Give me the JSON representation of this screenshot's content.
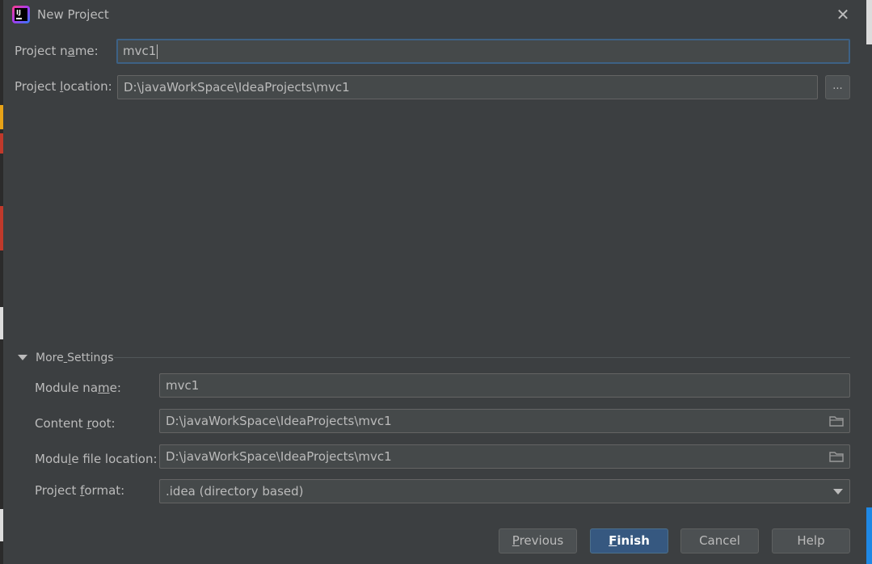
{
  "window": {
    "title": "New Project",
    "close_glyph": "✕"
  },
  "project": {
    "name_label_pre": "Project n",
    "name_label_u": "a",
    "name_label_post": "me:",
    "name_value": "mvc1",
    "location_label_pre": "Project ",
    "location_label_u": "l",
    "location_label_post": "ocation:",
    "location_value": "D:\\javaWorkSpace\\IdeaProjects\\mvc1",
    "browse_label": "..."
  },
  "more_settings": {
    "label_pre": "More",
    "label_u": " ",
    "label_post": "Settings",
    "module_name_label_pre": "Module na",
    "module_name_label_u": "m",
    "module_name_label_post": "e:",
    "module_name_value": "mvc1",
    "content_root_label_pre": "Content ",
    "content_root_label_u": "r",
    "content_root_label_post": "oot:",
    "content_root_value": "D:\\javaWorkSpace\\IdeaProjects\\mvc1",
    "module_file_label_pre": "Modu",
    "module_file_label_u": "l",
    "module_file_label_post": "e file location:",
    "module_file_value": "D:\\javaWorkSpace\\IdeaProjects\\mvc1",
    "format_label_pre": "Project ",
    "format_label_u": "f",
    "format_label_post": "ormat:",
    "format_value": ".idea (directory based)"
  },
  "buttons": {
    "previous_u": "P",
    "previous_rest": "revious",
    "finish_u": "F",
    "finish_rest": "inish",
    "cancel": "Cancel",
    "help": "Help"
  },
  "colors": {
    "background": "#3c3f41",
    "field": "#45494a",
    "focus_border": "#3d6185",
    "primary_button": "#365880"
  },
  "icons": [
    "intellij-app-icon",
    "close-icon",
    "folder-icon",
    "chevron-down-icon"
  ]
}
